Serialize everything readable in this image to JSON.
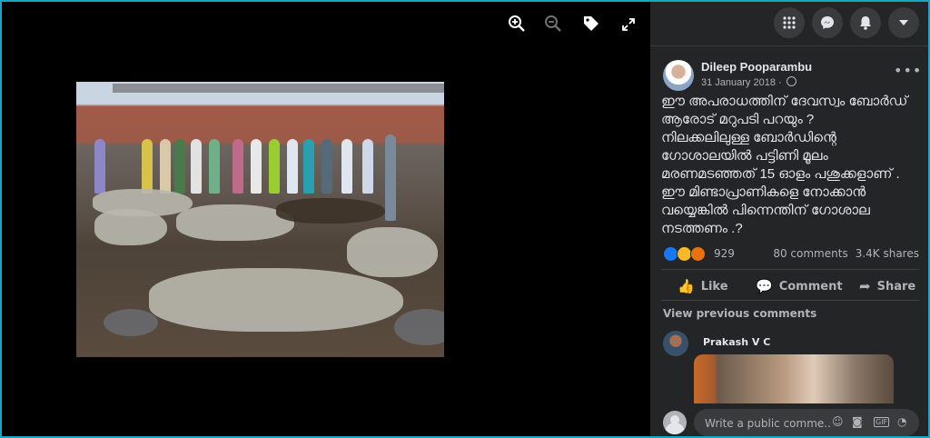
{
  "post": {
    "author": "Dileep Pooparambu",
    "date": "31 January 2018 · ",
    "body": "ഈ അപരാധത്തിന് ദേവസ്വം ബോർഡ്\nആരോട് മറുപടി പറയും ?\nനിലക്കലിലുള്ള ബോർഡിന്റെ\nഗോശാലയിൽ പട്ടിണി മൂലം\nമരണമടഞ്ഞത് 15 ഓളം പശുക്കളാണ് .\nഈ മിണ്ടാപ്രാണികളെ നോക്കാൻ\nവയ്യെങ്കിൽ പിന്നെന്തിന് ഗോശാല\nനടത്തണം .?",
    "reaction_count": "929",
    "comments_count": "80 comments",
    "shares_count": "3.4K shares",
    "reaction_colors": [
      "#1877f2",
      "#f7b928",
      "#e9710f"
    ]
  },
  "actions": {
    "like": "Like",
    "comment": "Comment",
    "share": "Share"
  },
  "comments": {
    "view_previous": "View previous comments",
    "first_commenter": "Prakash V C",
    "input_placeholder": "Write a public comme..."
  },
  "icons": {
    "viewer": [
      "zoom-in-icon",
      "zoom-out-icon",
      "tag-icon",
      "fullscreen-icon"
    ],
    "topbar": [
      "menu-grid-icon",
      "messenger-icon",
      "bell-icon",
      "caret-down-icon"
    ]
  }
}
